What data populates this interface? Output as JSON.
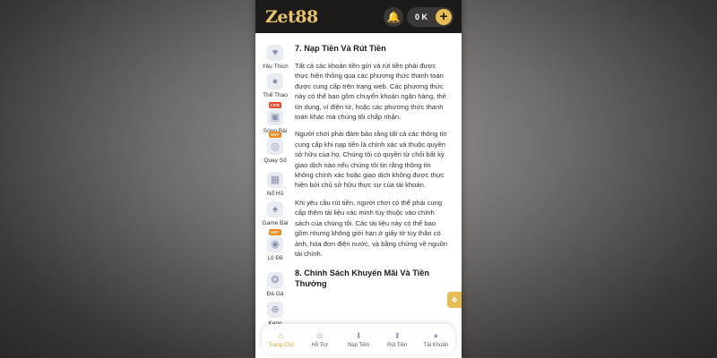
{
  "header": {
    "logo": "Zet88",
    "balance": "0 K",
    "bell_icon": "bell-icon",
    "plus_icon": "plus-icon"
  },
  "sidebar": {
    "items": [
      {
        "label": "Yêu Thích",
        "icon": "heart-icon",
        "glyph": "♥",
        "badge": ""
      },
      {
        "label": "Thể Thao",
        "icon": "ball-icon",
        "glyph": "●",
        "badge": ""
      },
      {
        "label": "Sòng Bài",
        "icon": "casino-icon",
        "glyph": "▣",
        "badge": "LIVE"
      },
      {
        "label": "Quay Số",
        "icon": "lottery-icon",
        "glyph": "◎",
        "badge": "HOT"
      },
      {
        "label": "Nổ Hũ",
        "icon": "slot-icon",
        "glyph": "▦",
        "badge": ""
      },
      {
        "label": "Game Bài",
        "icon": "cards-icon",
        "glyph": "♠",
        "badge": ""
      },
      {
        "label": "Lô Đề",
        "icon": "lotto-ball-icon",
        "glyph": "◉",
        "badge": "HOT"
      },
      {
        "label": "Đá Gà",
        "icon": "rooster-icon",
        "glyph": "❂",
        "badge": ""
      },
      {
        "label": "Keno",
        "icon": "keno-icon",
        "glyph": "⊕",
        "badge": ""
      }
    ]
  },
  "content": {
    "section7_title": "7. Nạp Tiền Và Rút Tiền",
    "p1": "Tất cả các khoản tiền gửi và rút tiền phải được thực hiện thông qua các phương thức thanh toán được cung cấp trên trang web. Các phương thức này có thể bao gồm chuyển khoản ngân hàng, thẻ tín dụng, ví điện tử, hoặc các phương thức thanh toán khác mà chúng tôi chấp nhận.",
    "p2": "Người chơi phải đảm bảo rằng tất cả các thông tin cung cấp khi nạp tiền là chính xác và thuộc quyền sở hữu của họ. Chúng tôi có quyền từ chối bất kỳ giao dịch nào nếu chúng tôi tin rằng thông tin không chính xác hoặc giao dịch không được thực hiện bởi chủ sở hữu thực sự của tài khoản.",
    "p3": "Khi yêu cầu rút tiền, người chơi có thể phải cung cấp thêm tài liệu xác minh tùy thuộc vào chính sách của chúng tôi. Các tài liệu này có thể bao gồm nhưng không giới hạn ở giấy tờ tùy thân có ảnh, hóa đơn điện nước, và bằng chứng về nguồn tài chính.",
    "section8_title": "8. Chính Sách Khuyến Mãi Và Tiền Thưởng"
  },
  "bottom_nav": {
    "items": [
      {
        "label": "Trang Chủ",
        "icon": "home-icon",
        "glyph": "⌂",
        "active": true
      },
      {
        "label": "Hỗ Trợ",
        "icon": "support-icon",
        "glyph": "☏",
        "active": false
      },
      {
        "label": "Nạp Tiền",
        "icon": "deposit-icon",
        "glyph": "⬇",
        "active": false
      },
      {
        "label": "Rút Tiền",
        "icon": "withdraw-icon",
        "glyph": "⬆",
        "active": false
      },
      {
        "label": "Tài Khoản",
        "icon": "account-icon",
        "glyph": "●",
        "active": false
      }
    ]
  },
  "float_button_icon": "gift-icon"
}
